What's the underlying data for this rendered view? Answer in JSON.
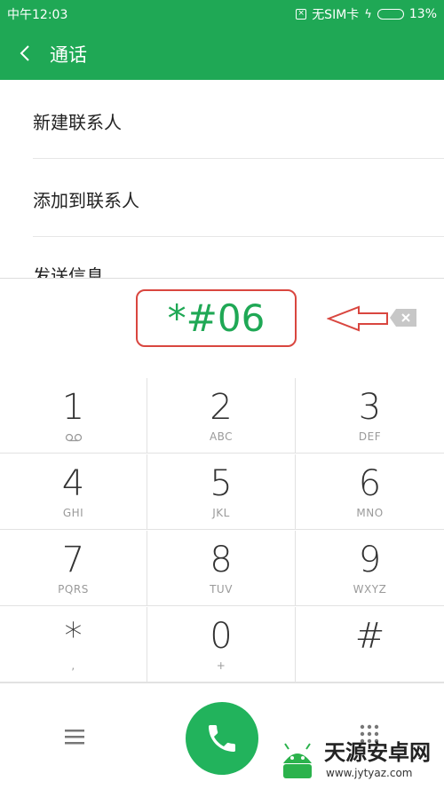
{
  "status_bar": {
    "time": "中午12:03",
    "sim_text": "无SIM卡",
    "battery": "13%",
    "battery_level": 0.13
  },
  "header": {
    "title": "通话"
  },
  "menu": {
    "items": [
      {
        "label": "新建联系人"
      },
      {
        "label": "添加到联系人"
      },
      {
        "label": "发送信息"
      }
    ]
  },
  "dialer": {
    "number": "*#06",
    "keys": [
      {
        "digit": "1",
        "letters": ""
      },
      {
        "digit": "2",
        "letters": "ABC"
      },
      {
        "digit": "3",
        "letters": "DEF"
      },
      {
        "digit": "4",
        "letters": "GHI"
      },
      {
        "digit": "5",
        "letters": "JKL"
      },
      {
        "digit": "6",
        "letters": "MNO"
      },
      {
        "digit": "7",
        "letters": "PQRS"
      },
      {
        "digit": "8",
        "letters": "TUV"
      },
      {
        "digit": "9",
        "letters": "WXYZ"
      },
      {
        "digit": "*",
        "letters": ","
      },
      {
        "digit": "0",
        "letters": "+"
      },
      {
        "digit": "#",
        "letters": ""
      }
    ]
  },
  "watermark": {
    "title": "天源安卓网",
    "url": "www.jytyaz.com"
  },
  "colors": {
    "accent": "#1fa855",
    "annotation": "#d9463f"
  },
  "icons": {
    "back": "chevron-left-icon",
    "voicemail": "voicemail-icon",
    "delete": "backspace-icon",
    "menu": "hamburger-menu-icon",
    "call": "phone-icon",
    "keypad": "dialpad-grid-icon"
  }
}
